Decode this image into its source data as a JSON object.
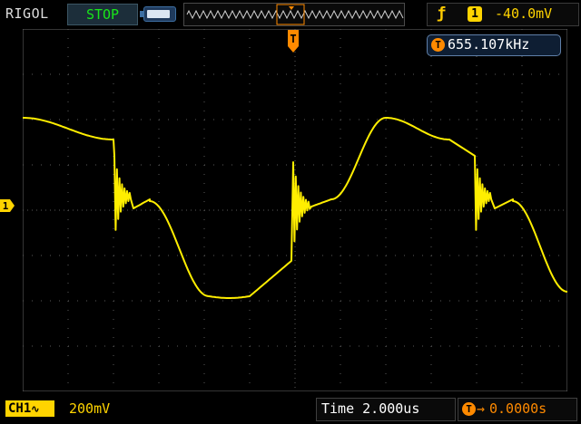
{
  "brand": "RIGOL",
  "run_state": "STOP",
  "trigger": {
    "edge_icon": "rising-edge-icon",
    "source": "1",
    "level": "-40.0mV"
  },
  "frequency": {
    "badge": "T",
    "value": "655.107kHz"
  },
  "channel": {
    "marker": "1",
    "label": "CH1",
    "coupling_icon": "ac-coupling-icon",
    "scale": "200mV"
  },
  "timebase": {
    "label": "Time",
    "value": "2.000us"
  },
  "trigger_offset": {
    "badge": "T",
    "arrow": "→",
    "value": "0.0000s"
  },
  "colors": {
    "trace": "#ffee00",
    "trigger_marker": "#ff8a00",
    "grid": "#5a5a5a",
    "run_state": "#19e619"
  }
}
